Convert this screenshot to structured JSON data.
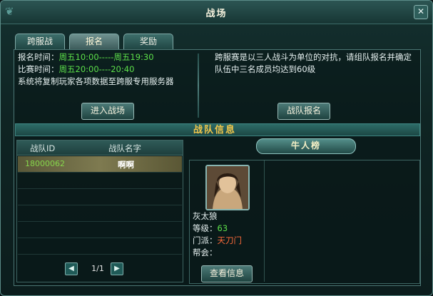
{
  "window": {
    "title": "战场",
    "close_label": "✕"
  },
  "tabs": [
    {
      "label": "跨服战",
      "active": false
    },
    {
      "label": "报名",
      "active": true
    },
    {
      "label": "奖励",
      "active": false
    }
  ],
  "info": {
    "signup_label": "报名时间：",
    "signup_value": "周五10:00-----周五19:30",
    "match_label": "比赛时间：",
    "match_value": "周五20:00----20:40",
    "system_note": "系统将复制玩家各项数据至跨服专用服务器"
  },
  "description": "跨服赛是以三人战斗为单位的对抗，请组队报名并确定队伍中三名成员均达到60级",
  "buttons": {
    "enter": "进入战场",
    "team_signup": "战队报名",
    "view_info": "查看信息"
  },
  "section_title": "战队信息",
  "team_table": {
    "headers": [
      "战队ID",
      "战队名字"
    ],
    "rows": [
      {
        "id": "18000062",
        "name": "啊啊"
      }
    ]
  },
  "pager": {
    "text": "1/1",
    "prev": "◀",
    "next": "▶"
  },
  "ranking": {
    "title": "牛人榜",
    "player": {
      "name": "灰太狼",
      "level_label": "等级：",
      "level": "63",
      "sect_label": "门派：",
      "sect": "天刀门",
      "guild_label": "帮会："
    }
  },
  "colors": {
    "accent_green": "#5de04a",
    "sect_red": "#ff6b3a",
    "banner_gold": "#f2c74b"
  }
}
